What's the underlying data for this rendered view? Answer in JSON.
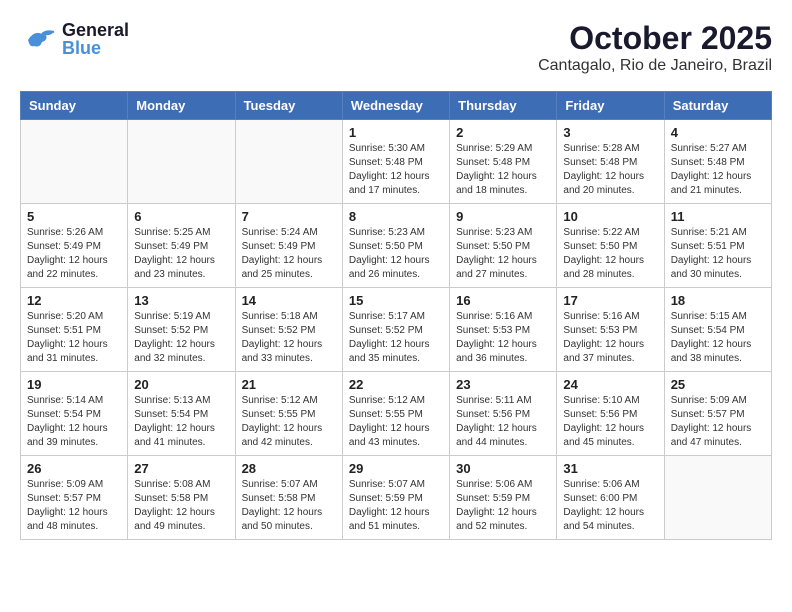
{
  "header": {
    "logo_general": "General",
    "logo_blue": "Blue",
    "month_title": "October 2025",
    "location": "Cantagalo, Rio de Janeiro, Brazil"
  },
  "days_of_week": [
    "Sunday",
    "Monday",
    "Tuesday",
    "Wednesday",
    "Thursday",
    "Friday",
    "Saturday"
  ],
  "weeks": [
    [
      {
        "day": "",
        "info": ""
      },
      {
        "day": "",
        "info": ""
      },
      {
        "day": "",
        "info": ""
      },
      {
        "day": "1",
        "info": "Sunrise: 5:30 AM\nSunset: 5:48 PM\nDaylight: 12 hours\nand 17 minutes."
      },
      {
        "day": "2",
        "info": "Sunrise: 5:29 AM\nSunset: 5:48 PM\nDaylight: 12 hours\nand 18 minutes."
      },
      {
        "day": "3",
        "info": "Sunrise: 5:28 AM\nSunset: 5:48 PM\nDaylight: 12 hours\nand 20 minutes."
      },
      {
        "day": "4",
        "info": "Sunrise: 5:27 AM\nSunset: 5:48 PM\nDaylight: 12 hours\nand 21 minutes."
      }
    ],
    [
      {
        "day": "5",
        "info": "Sunrise: 5:26 AM\nSunset: 5:49 PM\nDaylight: 12 hours\nand 22 minutes."
      },
      {
        "day": "6",
        "info": "Sunrise: 5:25 AM\nSunset: 5:49 PM\nDaylight: 12 hours\nand 23 minutes."
      },
      {
        "day": "7",
        "info": "Sunrise: 5:24 AM\nSunset: 5:49 PM\nDaylight: 12 hours\nand 25 minutes."
      },
      {
        "day": "8",
        "info": "Sunrise: 5:23 AM\nSunset: 5:50 PM\nDaylight: 12 hours\nand 26 minutes."
      },
      {
        "day": "9",
        "info": "Sunrise: 5:23 AM\nSunset: 5:50 PM\nDaylight: 12 hours\nand 27 minutes."
      },
      {
        "day": "10",
        "info": "Sunrise: 5:22 AM\nSunset: 5:50 PM\nDaylight: 12 hours\nand 28 minutes."
      },
      {
        "day": "11",
        "info": "Sunrise: 5:21 AM\nSunset: 5:51 PM\nDaylight: 12 hours\nand 30 minutes."
      }
    ],
    [
      {
        "day": "12",
        "info": "Sunrise: 5:20 AM\nSunset: 5:51 PM\nDaylight: 12 hours\nand 31 minutes."
      },
      {
        "day": "13",
        "info": "Sunrise: 5:19 AM\nSunset: 5:52 PM\nDaylight: 12 hours\nand 32 minutes."
      },
      {
        "day": "14",
        "info": "Sunrise: 5:18 AM\nSunset: 5:52 PM\nDaylight: 12 hours\nand 33 minutes."
      },
      {
        "day": "15",
        "info": "Sunrise: 5:17 AM\nSunset: 5:52 PM\nDaylight: 12 hours\nand 35 minutes."
      },
      {
        "day": "16",
        "info": "Sunrise: 5:16 AM\nSunset: 5:53 PM\nDaylight: 12 hours\nand 36 minutes."
      },
      {
        "day": "17",
        "info": "Sunrise: 5:16 AM\nSunset: 5:53 PM\nDaylight: 12 hours\nand 37 minutes."
      },
      {
        "day": "18",
        "info": "Sunrise: 5:15 AM\nSunset: 5:54 PM\nDaylight: 12 hours\nand 38 minutes."
      }
    ],
    [
      {
        "day": "19",
        "info": "Sunrise: 5:14 AM\nSunset: 5:54 PM\nDaylight: 12 hours\nand 39 minutes."
      },
      {
        "day": "20",
        "info": "Sunrise: 5:13 AM\nSunset: 5:54 PM\nDaylight: 12 hours\nand 41 minutes."
      },
      {
        "day": "21",
        "info": "Sunrise: 5:12 AM\nSunset: 5:55 PM\nDaylight: 12 hours\nand 42 minutes."
      },
      {
        "day": "22",
        "info": "Sunrise: 5:12 AM\nSunset: 5:55 PM\nDaylight: 12 hours\nand 43 minutes."
      },
      {
        "day": "23",
        "info": "Sunrise: 5:11 AM\nSunset: 5:56 PM\nDaylight: 12 hours\nand 44 minutes."
      },
      {
        "day": "24",
        "info": "Sunrise: 5:10 AM\nSunset: 5:56 PM\nDaylight: 12 hours\nand 45 minutes."
      },
      {
        "day": "25",
        "info": "Sunrise: 5:09 AM\nSunset: 5:57 PM\nDaylight: 12 hours\nand 47 minutes."
      }
    ],
    [
      {
        "day": "26",
        "info": "Sunrise: 5:09 AM\nSunset: 5:57 PM\nDaylight: 12 hours\nand 48 minutes."
      },
      {
        "day": "27",
        "info": "Sunrise: 5:08 AM\nSunset: 5:58 PM\nDaylight: 12 hours\nand 49 minutes."
      },
      {
        "day": "28",
        "info": "Sunrise: 5:07 AM\nSunset: 5:58 PM\nDaylight: 12 hours\nand 50 minutes."
      },
      {
        "day": "29",
        "info": "Sunrise: 5:07 AM\nSunset: 5:59 PM\nDaylight: 12 hours\nand 51 minutes."
      },
      {
        "day": "30",
        "info": "Sunrise: 5:06 AM\nSunset: 5:59 PM\nDaylight: 12 hours\nand 52 minutes."
      },
      {
        "day": "31",
        "info": "Sunrise: 5:06 AM\nSunset: 6:00 PM\nDaylight: 12 hours\nand 54 minutes."
      },
      {
        "day": "",
        "info": ""
      }
    ]
  ]
}
